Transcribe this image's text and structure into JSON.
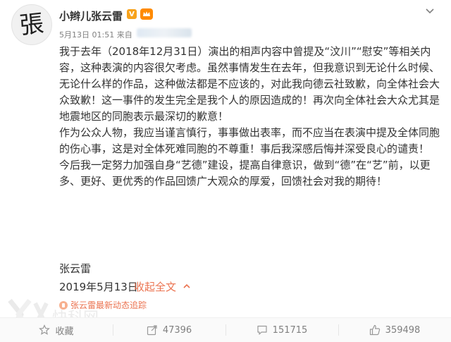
{
  "post": {
    "author": {
      "name": "小辫儿张云雷",
      "avatar_glyph": "張",
      "verified_badge": "V",
      "level_badge_icon": "fan-level-icon"
    },
    "meta": {
      "time": "5月13日 01:51",
      "source_prefix": "来自"
    },
    "paragraphs": [
      "我于去年（2018年12月31日）演出的相声内容中曾提及“汶川”“慰安”等相关内容，这种表演的内容很欠考虑。虽然事情发生在去年，但我意识到无论什么时候、无论什么样的作品，这种做法都是不应该的，对此我向德云社致歉，向全体社会大众致歉！这一事件的发生完全是我个人的原因造成的！再次向全体社会大众尤其是地震地区的同胞表示最深切的歉意！",
      "作为公众人物，我应当谨言慎行，事事做出表率，而不应当在表演中提及全体同胞的伤心事，这是对全体死难同胞的不尊重！事后我深感后悔并深受良心的谴责！",
      "今后我一定努力加强自身“艺德”建设，提高自律意识，做到“德”在“艺”前，以更多、更好、更优秀的作品回馈广大观众的厚爱，回馈社会对我的期待！"
    ],
    "signature": "张云雷",
    "date": "2019年5月13日",
    "collapse_label": "收起全文",
    "tracker_label": "张云雷最新动态追踪"
  },
  "actions": [
    {
      "icon": "star-icon",
      "label": "收藏"
    },
    {
      "icon": "share-icon",
      "label": "47396"
    },
    {
      "icon": "comment-icon",
      "label": "151715"
    },
    {
      "icon": "like-icon",
      "label": "359498"
    }
  ],
  "watermark_text": "快科网",
  "colors": {
    "accent": "#eb7350",
    "text": "#333333",
    "muted": "#808080"
  }
}
